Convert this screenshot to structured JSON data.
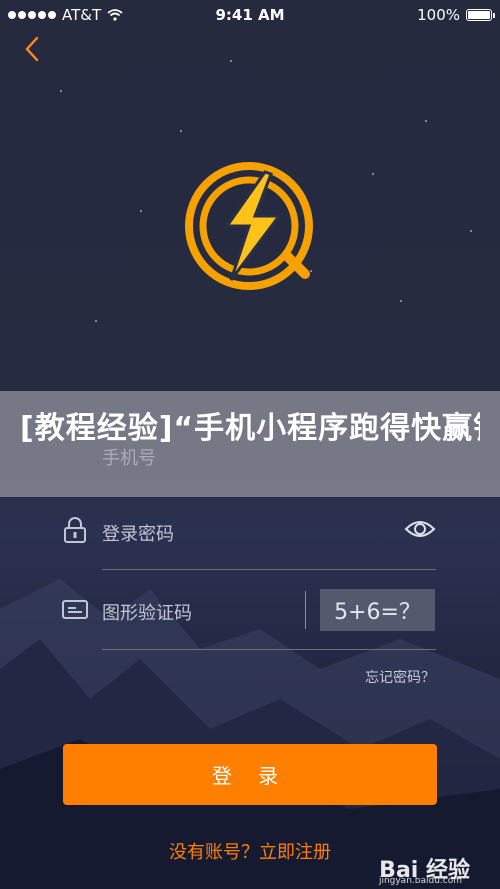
{
  "status_bar": {
    "carrier": "AT&T",
    "time": "9:41 AM",
    "battery": "100%",
    "battery_level": 1.0
  },
  "banner": {
    "text": "[教程经验]“手机小程序跑得快赢钱软件”(透视挂)辅"
  },
  "form": {
    "phone_placeholder": "手机号",
    "password_placeholder": "登录密码",
    "captcha_placeholder": "图形验证码",
    "captcha_text": "5+6=？",
    "forgot_password": "忘记密码？"
  },
  "login_button": "登 录",
  "register_link": "没有账号？立即注册",
  "watermark": {
    "main": "Bai 经验",
    "sub": "jingyan.baidu.com"
  },
  "colors": {
    "accent": "#ff7f00",
    "background": "#262b41"
  },
  "icons": [
    "back-icon",
    "signal-dots-icon",
    "wifi-icon",
    "battery-icon",
    "lightning-logo-icon",
    "lock-icon",
    "eye-icon",
    "card-icon"
  ]
}
